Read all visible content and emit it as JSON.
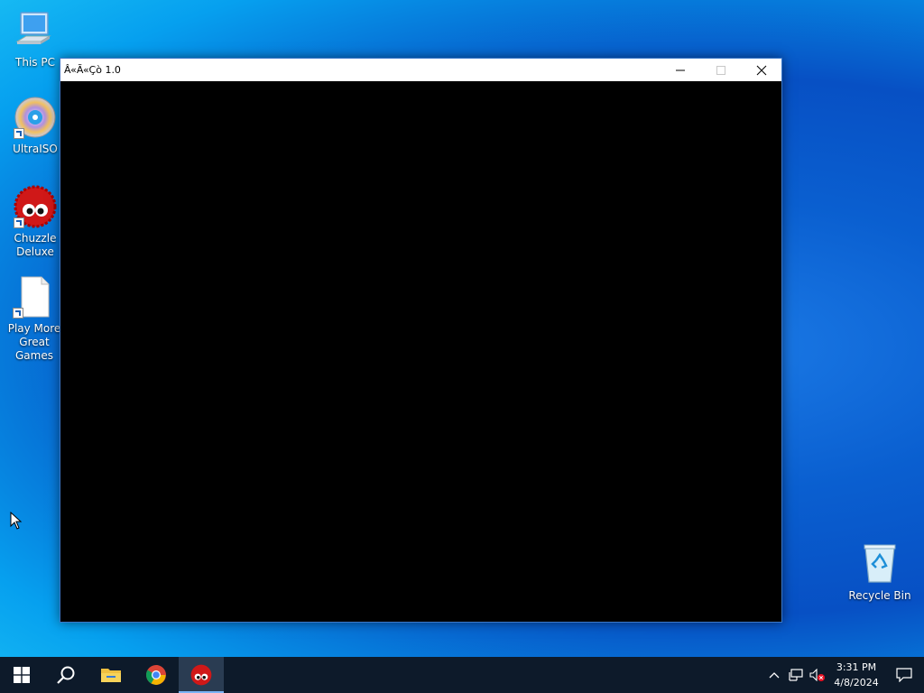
{
  "desktop": {
    "icons": [
      {
        "label": "This PC"
      },
      {
        "label": "UltraISO"
      },
      {
        "label": "Chuzzle Deluxe"
      },
      {
        "label": "Play More Great Games"
      },
      {
        "label": "Recycle Bin"
      }
    ]
  },
  "window": {
    "title": "Â«Ã«Çò 1.0",
    "client_color": "#000000"
  },
  "taskbar": {
    "items": [
      {
        "icon": "windows-start-icon"
      },
      {
        "icon": "search-icon"
      },
      {
        "icon": "file-explorer-icon"
      },
      {
        "icon": "chrome-icon"
      },
      {
        "icon": "chuzzle-icon",
        "active": true
      }
    ],
    "tray": {
      "time": "3:31 PM",
      "date": "4/8/2024"
    }
  },
  "colors": {
    "accent": "#0a5fd0",
    "taskbar": "#0d1a2a"
  }
}
